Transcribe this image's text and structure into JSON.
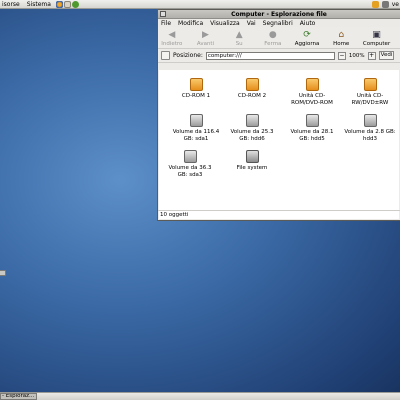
{
  "top_panel": {
    "menu_risorse": "isorse",
    "menu_sistema": "Sistema",
    "username": "ve",
    "launchers": [
      "firefox-icon",
      "mail-icon",
      "help-icon"
    ]
  },
  "window": {
    "title": "Computer - Esplorazione file",
    "menu": [
      "File",
      "Modifica",
      "Visualizza",
      "Vai",
      "Segnalibri",
      "Aiuto"
    ],
    "toolbar": [
      {
        "label": "Indietro",
        "icon": "back-arrow-icon",
        "enabled": false
      },
      {
        "label": "Avanti",
        "icon": "forward-arrow-icon",
        "enabled": false
      },
      {
        "label": "Su",
        "icon": "up-arrow-icon",
        "enabled": false
      },
      {
        "label": "Ferma",
        "icon": "stop-icon",
        "enabled": false
      },
      {
        "label": "Aggiorna",
        "icon": "reload-icon",
        "enabled": true
      },
      {
        "label": "Home",
        "icon": "home-icon",
        "enabled": true
      },
      {
        "label": "Computer",
        "icon": "computer-icon",
        "enabled": true
      }
    ],
    "location_label": "Posizione:",
    "location_value": "computer:///",
    "zoom": "100%",
    "view_button": "Vedi",
    "items": [
      {
        "label": "CD-ROM 1",
        "kind": "cd"
      },
      {
        "label": "CD-ROM 2",
        "kind": "cd"
      },
      {
        "label": "Unità CD-ROM/DVD-ROM",
        "kind": "cd"
      },
      {
        "label": "Unità CD-RW/DVD±RW",
        "kind": "cd"
      },
      {
        "label": "Volume da 116.4 GB: sda1",
        "kind": "hdd"
      },
      {
        "label": "Volume da 25.3 GB: hdd6",
        "kind": "hdd"
      },
      {
        "label": "Volume da 28.1 GB: hdd5",
        "kind": "hdd"
      },
      {
        "label": "Volume da 2.8 GB: hdd3",
        "kind": "hdd"
      },
      {
        "label": "Volume da 36.3 GB: sda3",
        "kind": "hdd"
      },
      {
        "label": "File system",
        "kind": "fs"
      }
    ],
    "status": "10 oggetti"
  },
  "bottom_panel": {
    "task_label": "- Esploraz..."
  }
}
